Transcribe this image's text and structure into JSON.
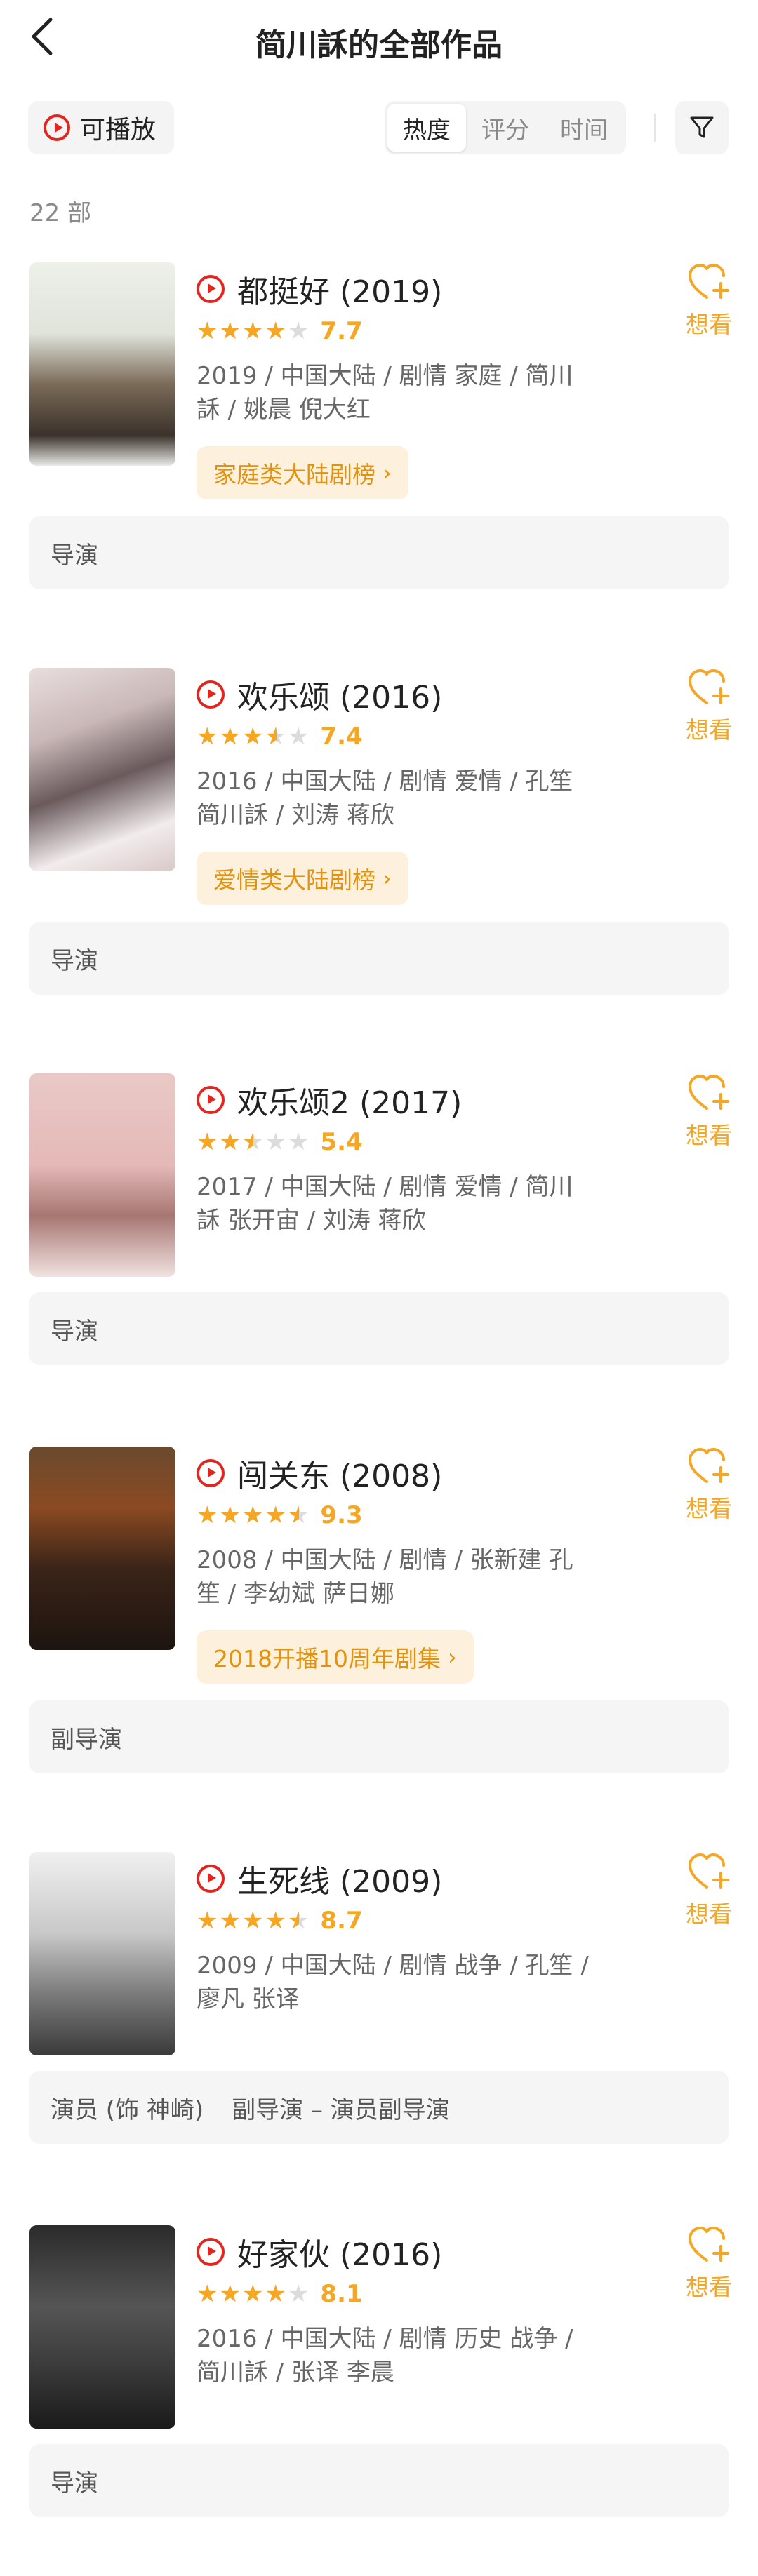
{
  "header": {
    "title": "简川訸的全部作品"
  },
  "toolbar": {
    "playable_label": "可播放",
    "sort_tabs": [
      "热度",
      "评分",
      "时间"
    ],
    "active_sort": "热度"
  },
  "count_text": "22 部",
  "want_label": "想看",
  "colors": {
    "accent": "#f5a623",
    "play_red": "#e0261f",
    "tag_bg": "#fdf1de"
  },
  "works": [
    {
      "title": "都挺好 (2019)",
      "rating": 7.7,
      "stars_fraction": 0.8,
      "score": "7.7",
      "meta": "2019 / 中国大陆 / 剧情 家庭 / 简川訸 / 姚晨 倪大红",
      "tag": "家庭类大陆剧榜",
      "role": "导演",
      "role_extra": ""
    },
    {
      "title": "欢乐颂 (2016)",
      "rating": 7.4,
      "stars_fraction": 0.7,
      "score": "7.4",
      "meta": "2016 / 中国大陆 / 剧情 爱情 / 孔笙 简川訸 / 刘涛 蒋欣",
      "tag": "爱情类大陆剧榜",
      "role": "导演",
      "role_extra": ""
    },
    {
      "title": "欢乐颂2 (2017)",
      "rating": 5.4,
      "stars_fraction": 0.5,
      "score": "5.4",
      "meta": "2017 / 中国大陆 / 剧情 爱情 / 简川訸 张开宙 / 刘涛 蒋欣",
      "tag": "",
      "role": "导演",
      "role_extra": ""
    },
    {
      "title": "闯关东 (2008)",
      "rating": 9.3,
      "stars_fraction": 0.9,
      "score": "9.3",
      "meta": "2008 / 中国大陆 / 剧情 / 张新建 孔笙 / 李幼斌 萨日娜",
      "tag": "2018开播10周年剧集",
      "role": "副导演",
      "role_extra": ""
    },
    {
      "title": "生死线 (2009)",
      "rating": 8.7,
      "stars_fraction": 0.9,
      "score": "8.7",
      "meta": "2009 / 中国大陆 / 剧情 战争 / 孔笙 / 廖凡 张译",
      "tag": "",
      "role": "演员 (饰 神崎)",
      "role_extra": "副导演 – 演员副导演"
    },
    {
      "title": "好家伙 (2016)",
      "rating": 8.1,
      "stars_fraction": 0.8,
      "score": "8.1",
      "meta": "2016 / 中国大陆 / 剧情 历史 战争 / 简川訸 / 张译 李晨",
      "tag": "",
      "role": "导演",
      "role_extra": ""
    }
  ]
}
